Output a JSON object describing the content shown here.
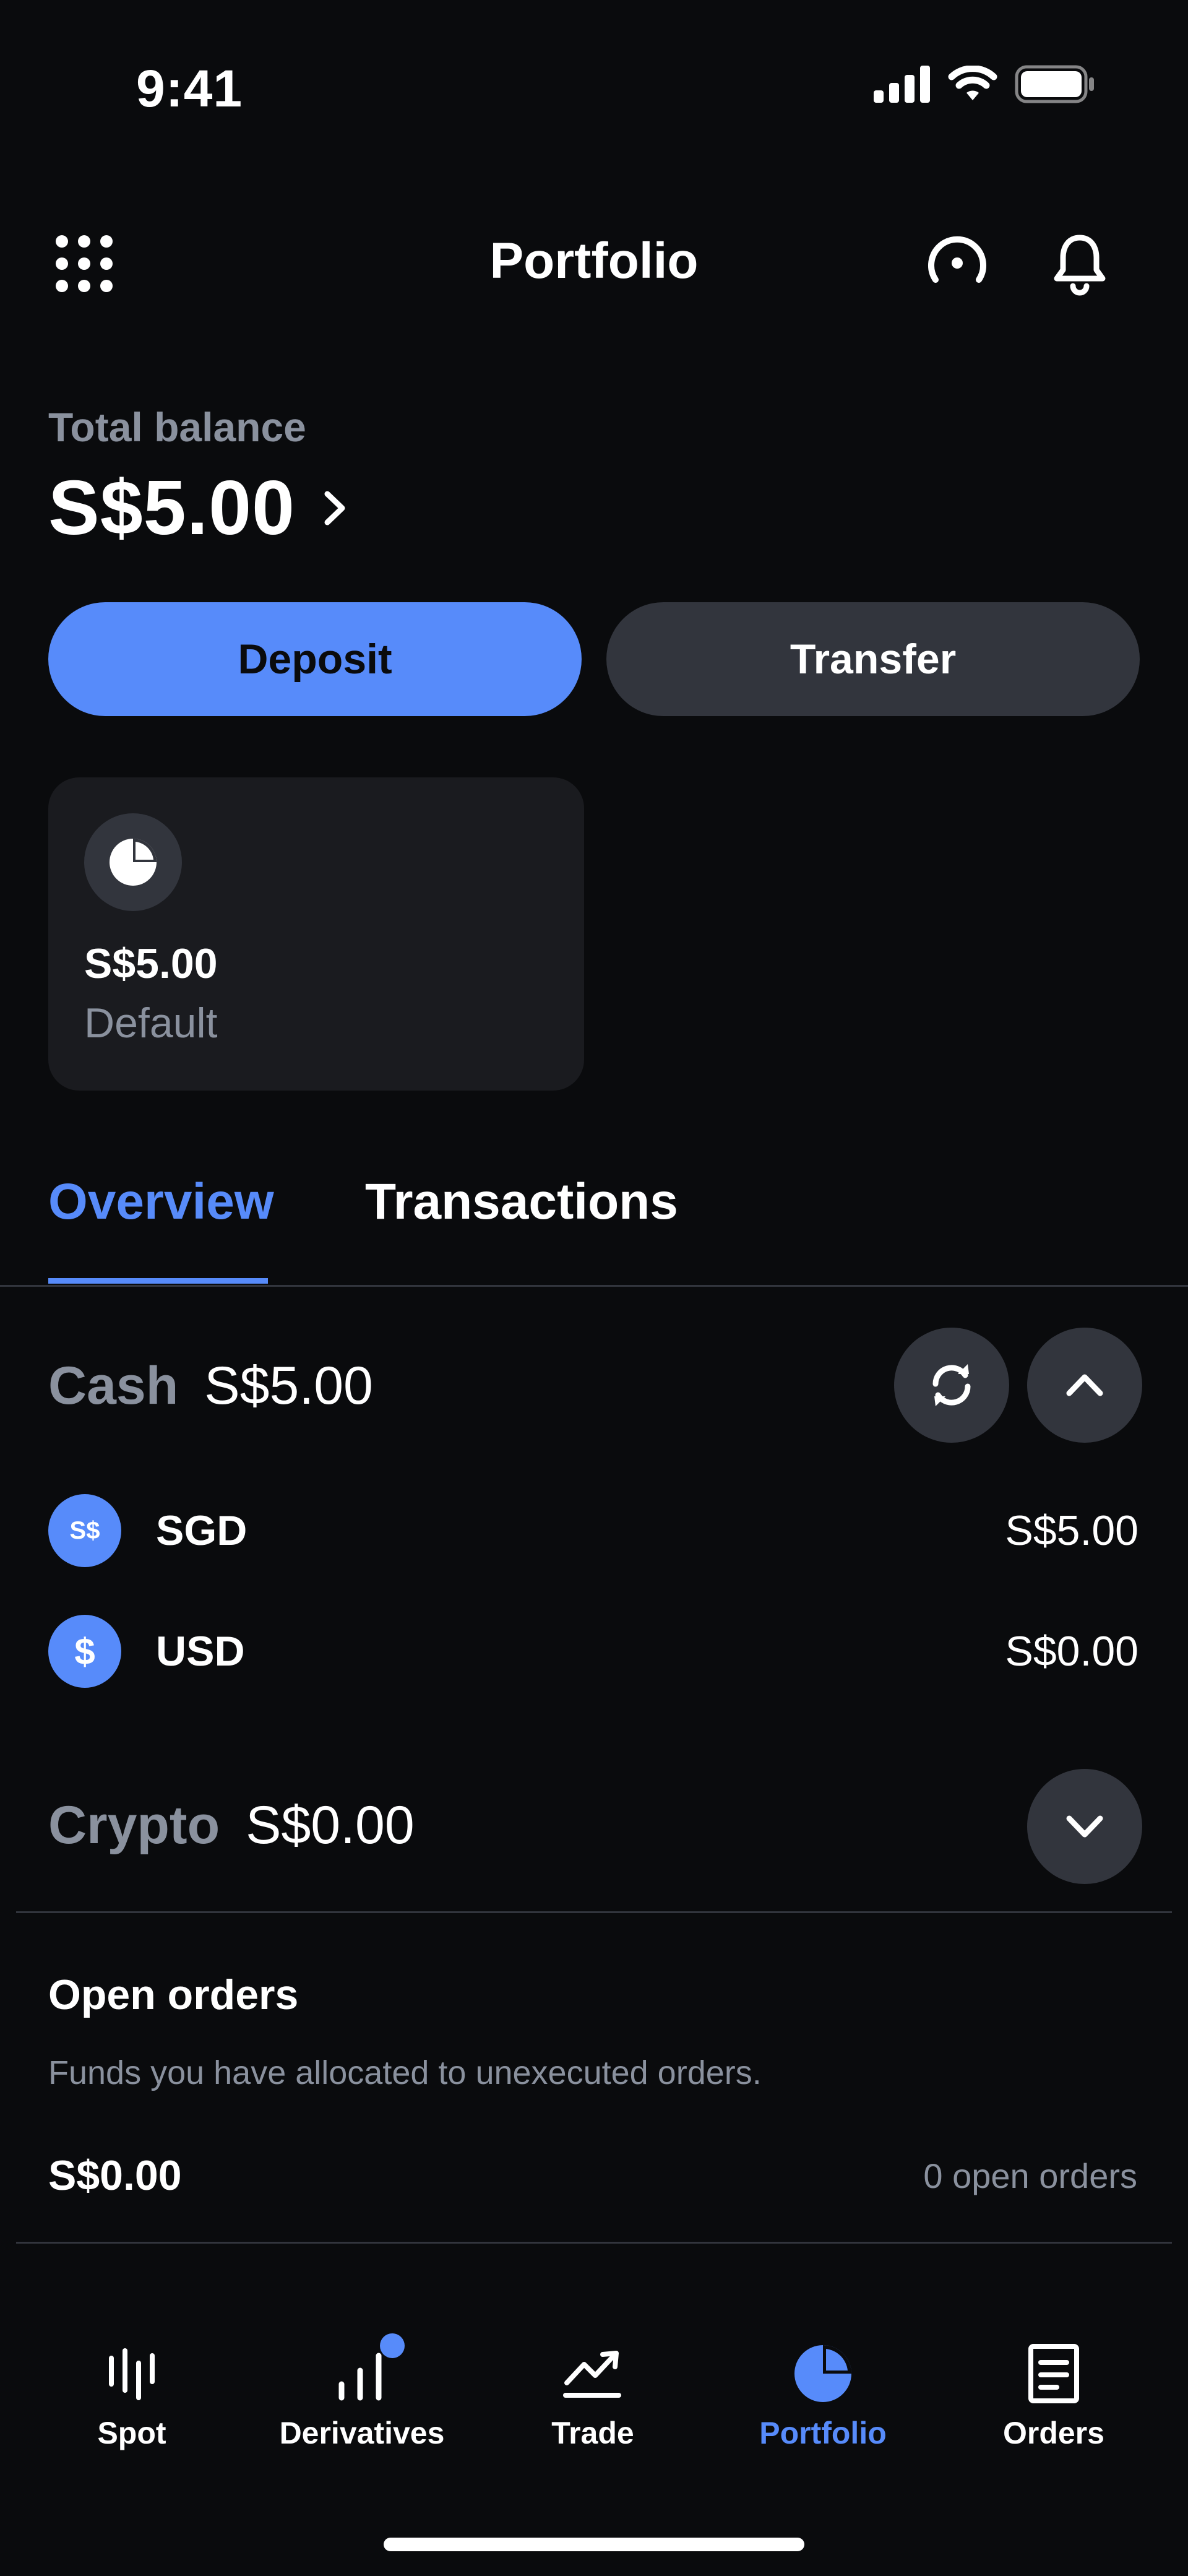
{
  "status_bar": {
    "time": "9:41"
  },
  "header": {
    "title": "Portfolio"
  },
  "balance": {
    "label": "Total balance",
    "value": "S$5.00"
  },
  "actions": {
    "deposit": "Deposit",
    "transfer": "Transfer"
  },
  "account_card": {
    "amount": "S$5.00",
    "label": "Default"
  },
  "tabs": [
    {
      "label": "Overview",
      "active": true
    },
    {
      "label": "Transactions",
      "active": false
    }
  ],
  "cash": {
    "title": "Cash",
    "total": "S$5.00",
    "assets": [
      {
        "icon_text": "S$",
        "name": "SGD",
        "value": "S$5.00"
      },
      {
        "icon_text": "$",
        "name": "USD",
        "value": "S$0.00"
      }
    ]
  },
  "crypto": {
    "title": "Crypto",
    "total": "S$0.00"
  },
  "open_orders": {
    "title": "Open orders",
    "description": "Funds you have allocated to unexecuted orders.",
    "amount": "S$0.00",
    "count": "0 open orders"
  },
  "nav": [
    {
      "label": "Spot",
      "icon": "spot-icon"
    },
    {
      "label": "Derivatives",
      "icon": "derivatives-icon"
    },
    {
      "label": "Trade",
      "icon": "trade-icon"
    },
    {
      "label": "Portfolio",
      "icon": "portfolio-icon",
      "active": true
    },
    {
      "label": "Orders",
      "icon": "orders-icon"
    }
  ],
  "colors": {
    "accent": "#578bfa",
    "background": "#0a0b0d",
    "card": "#1a1b1f",
    "muted": "#8a919e",
    "button_secondary": "#32353d"
  }
}
